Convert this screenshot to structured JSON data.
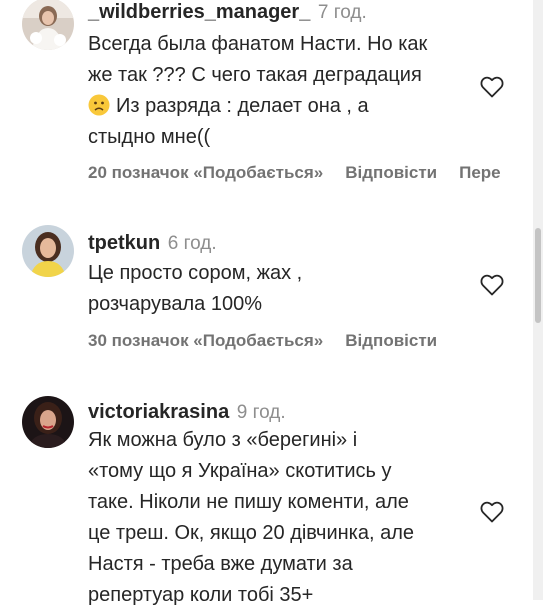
{
  "comments": [
    {
      "username": "_wildberries_manager_",
      "time": "7 год.",
      "lines": [
        "Всегда была фанатом Насти. Но как",
        "же так ??? С чего такая деградация",
        "Из разряда : делает она , а",
        "стыдно мне(("
      ],
      "emoji_icon": "sad-face-emoji",
      "likes": "20 позначок «Подобається»",
      "reply": "Відповісти",
      "more": "Пере"
    },
    {
      "username": "tpetkun",
      "time": "6 год.",
      "lines": [
        "Це просто сором, жах ,",
        "розчарувала 100%"
      ],
      "likes": "30 позначок «Подобається»",
      "reply": "Відповісти"
    },
    {
      "username": "victoriakrasina",
      "time": "9 год.",
      "lines": [
        "Як можна було з «берегині» і",
        "«тому що я Україна» скотитись у",
        "таке. Ніколи не пишу коменти, але",
        "це треш. Ок, якщо 20 дівчинка, але",
        "Настя - треба вже думати за",
        "репертуар коли тобі 35+"
      ]
    }
  ],
  "icons": {
    "like": "heart-outline-icon"
  },
  "colors": {
    "text": "#262626",
    "secondary": "#8e8e8e",
    "actions": "#737373"
  }
}
